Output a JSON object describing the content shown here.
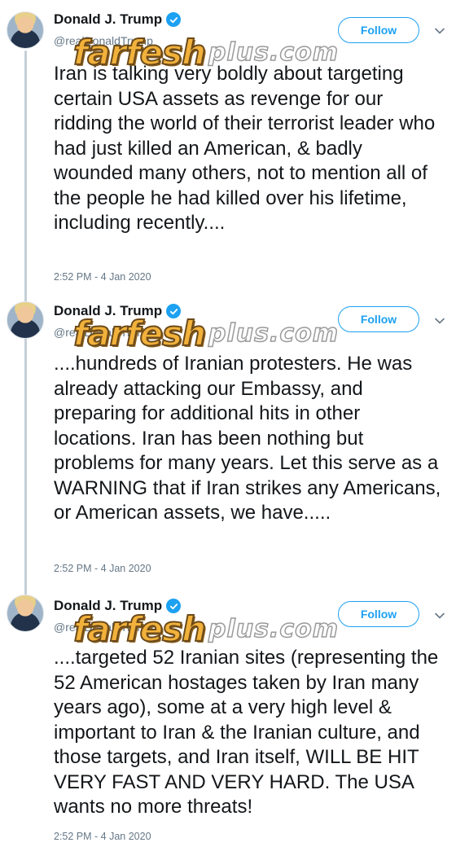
{
  "thread": {
    "tweets": [
      {
        "display_name": "Donald J. Trump",
        "handle": "@realDonaldTrump",
        "follow_label": "Follow",
        "text": "Iran is talking very boldly about targeting certain USA assets as revenge for our ridding the world of their terrorist leader who had just killed an American, & badly wounded many others, not to mention all of the people he had killed over his lifetime, including recently....",
        "timestamp": "2:52 PM - 4 Jan 2020"
      },
      {
        "display_name": "Donald J. Trump",
        "handle": "@realDonaldTrump",
        "follow_label": "Follow",
        "text": "....hundreds of Iranian protesters. He was already attacking our Embassy, and preparing for additional hits in other locations. Iran has been nothing but problems for many years. Let this serve as a WARNING that if Iran strikes any Americans, or American assets, we have.....",
        "timestamp": "2:52 PM - 4 Jan 2020"
      },
      {
        "display_name": "Donald J. Trump",
        "handle": "@realDonaldTrump",
        "follow_label": "Follow",
        "text": "....targeted 52 Iranian sites (representing the 52 American hostages taken by Iran many years ago), some at a very high level & important to Iran &  the Iranian culture, and those targets, and Iran itself, WILL BE HIT VERY FAST AND VERY HARD. The USA wants no more threats!",
        "timestamp": "2:52 PM - 4 Jan 2020"
      }
    ]
  },
  "watermark": {
    "brand": "farfesh",
    "suffix": "plus.com"
  },
  "icons": {
    "verified": "verified-badge-icon",
    "more": "chevron-down-icon"
  },
  "colors": {
    "accent": "#1da1f2",
    "text": "#14171a",
    "muted": "#657786",
    "thread_line": "#c4cfd6"
  }
}
